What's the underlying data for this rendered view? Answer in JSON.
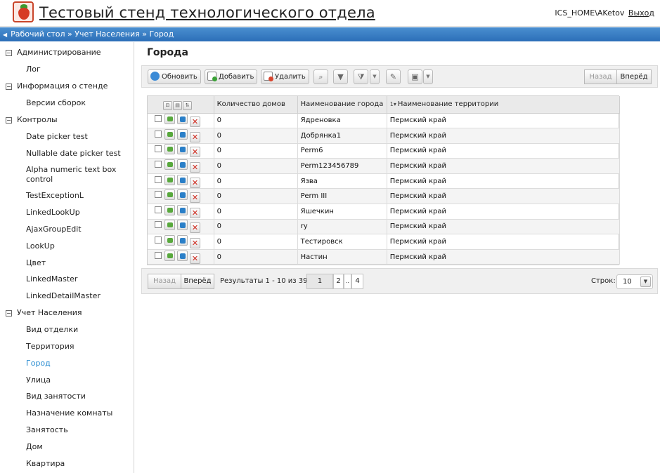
{
  "header": {
    "title": "Тестовый стенд технологического отдела",
    "user": "ICS_HOME\\AKetov",
    "logout_label": "Выход"
  },
  "breadcrumb": {
    "text": "Рабочий стол » Учет Населения » Город"
  },
  "sidebar": {
    "groups": [
      {
        "label": "Администрирование",
        "items": [
          "Лог"
        ]
      },
      {
        "label": "Информация о стенде",
        "items": [
          "Версии сборок"
        ]
      },
      {
        "label": "Контролы",
        "items": [
          "Date picker test",
          "Nullable date picker test",
          "Alpha numeric text box control",
          "TestExceptionL",
          "LinkedLookUp",
          "AjaxGroupEdit",
          "LookUp",
          "Цвет",
          "LinkedMaster",
          "LinkedDetailMaster"
        ]
      },
      {
        "label": "Учет Населения",
        "items": [
          "Вид отделки",
          "Территория",
          "Город",
          "Улица",
          "Вид занятости",
          "Назначение комнаты",
          "Занятость",
          "Дом",
          "Квартира"
        ]
      }
    ],
    "active_item": "Город"
  },
  "main": {
    "title": "Города",
    "toolbar": {
      "refresh_label": "Обновить",
      "add_label": "Добавить",
      "delete_label": "Удалить",
      "back_label": "Назад",
      "forward_label": "Вперёд"
    },
    "grid": {
      "columns": [
        "Количество домов",
        "Наименование города",
        "Наименование территории"
      ],
      "sort_indicator": "1▾",
      "rows": [
        {
          "houses": "0",
          "city": "Ядреновка",
          "territory": "Пермский край"
        },
        {
          "houses": "0",
          "city": "Добрянка1",
          "territory": "Пермский край"
        },
        {
          "houses": "0",
          "city": "Perm6",
          "territory": "Пермский край"
        },
        {
          "houses": "0",
          "city": "Perm123456789",
          "territory": "Пермский край"
        },
        {
          "houses": "0",
          "city": "Язва",
          "territory": "Пермский край"
        },
        {
          "houses": "0",
          "city": "Perm III",
          "territory": "Пермский край"
        },
        {
          "houses": "0",
          "city": "Яшечкин",
          "territory": "Пермский край"
        },
        {
          "houses": "0",
          "city": "ry",
          "territory": "Пермский край"
        },
        {
          "houses": "0",
          "city": "Тестировск",
          "territory": "Пермский край"
        },
        {
          "houses": "0",
          "city": "Настин",
          "territory": "Пермский край"
        }
      ]
    },
    "pager": {
      "back_label": "Назад",
      "forward_label": "Вперёд",
      "results_text": "Результаты 1 - 10 из 39",
      "pages": [
        "1",
        "2",
        "..",
        "4"
      ],
      "rows_label": "Строк:",
      "rows_value": "10"
    }
  },
  "colors": {
    "breadcrumb_bar": "#2c6fb8",
    "active_link": "#2e8fd2",
    "delete_red": "#d02a1e"
  }
}
